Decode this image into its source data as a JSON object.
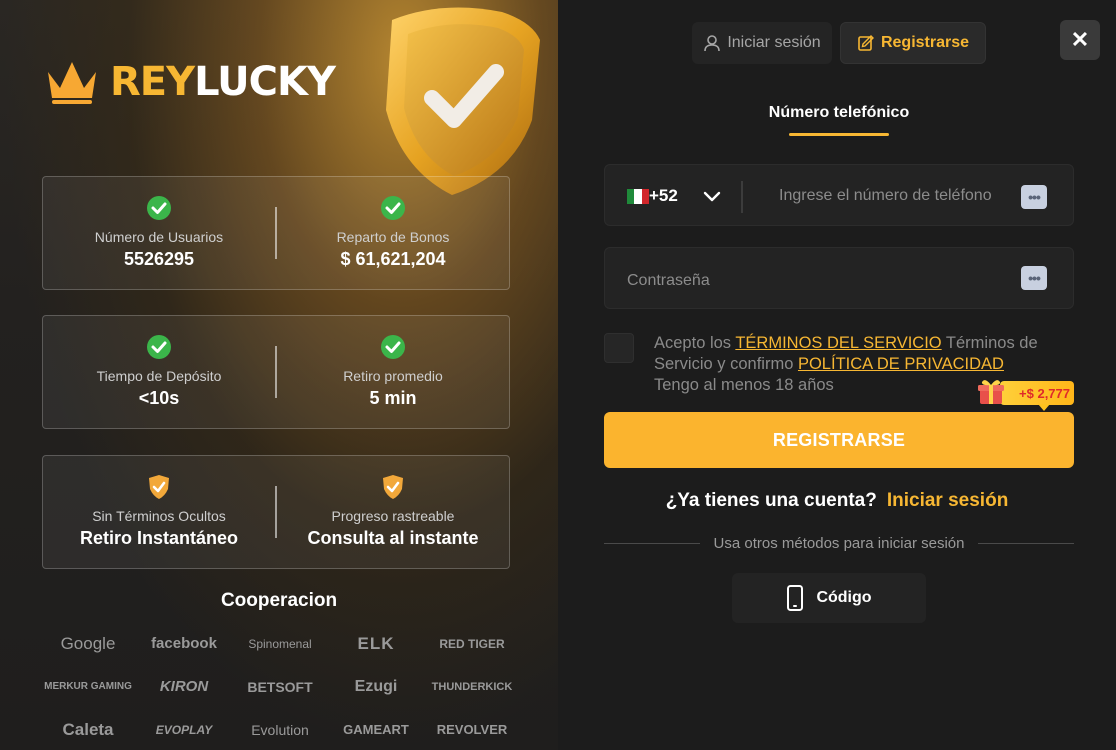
{
  "brand": {
    "part1": "REY",
    "part2": "LUCKY",
    "accent_color": "#f7b733"
  },
  "stats": [
    {
      "left": {
        "icon": "check-circle-icon",
        "label": "Número de Usuarios",
        "value": "5526295"
      },
      "right": {
        "icon": "check-circle-icon",
        "label": "Reparto de Bonos",
        "value": "$ 61,621,204"
      }
    },
    {
      "left": {
        "icon": "check-circle-icon",
        "label": "Tiempo de Depósito",
        "value": "<10s"
      },
      "right": {
        "icon": "check-circle-icon",
        "label": "Retiro promedio",
        "value": "5 min"
      }
    },
    {
      "left": {
        "icon": "shield-check-icon",
        "label": "Sin Términos Ocultos",
        "value": "Retiro Instantáneo"
      },
      "right": {
        "icon": "shield-check-icon",
        "label": "Progreso rastreable",
        "value": "Consulta al instante"
      }
    }
  ],
  "cooperation": {
    "title": "Cooperacion",
    "partners": [
      "Google",
      "facebook",
      "Spinomenal",
      "ELK",
      "RED TIGER",
      "MERKUR GAMING",
      "KIRON",
      "BETSOFT",
      "Ezugi",
      "THUNDERKICK",
      "Caleta",
      "EVOPLAY",
      "Evolution",
      "GAMEART",
      "REVOLVER"
    ]
  },
  "header": {
    "login_tab": "Iniciar sesión",
    "register_tab": "Registrarse",
    "close_icon": "close-icon"
  },
  "form": {
    "active_tab": "Número telefónico",
    "country_code": "+52",
    "country_flag": "mexico-flag-icon",
    "phone_placeholder": "Ingrese el número de teléfono",
    "password_placeholder": "Contraseña",
    "terms": {
      "prefix": "Acepto los ",
      "terms_link": "TÉRMINOS DEL SERVICIO",
      "middle": " Términos de Servicio y confirmo ",
      "privacy_link": "POLÍTICA DE PRIVACIDAD",
      "age": "Tengo al menos 18 años",
      "checked": false
    },
    "bonus_badge": "+$ 2,777",
    "submit_label": "REGISTRARSE",
    "have_account": "¿Ya tienes una cuenta?",
    "login_link": "Iniciar sesión",
    "other_methods": "Usa otros métodos para iniciar sesión",
    "code_button": "Código"
  }
}
